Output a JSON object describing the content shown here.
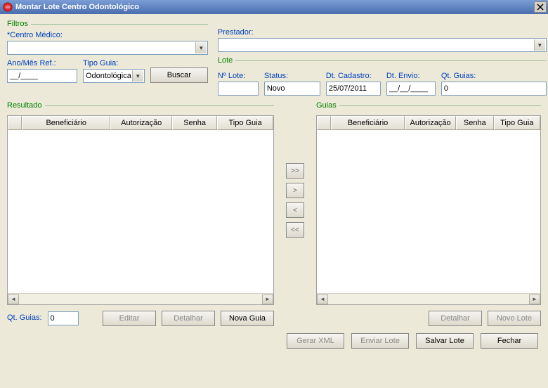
{
  "title": "Montar Lote Centro Odontológico",
  "close_x": "X",
  "fieldset_labels": {
    "filtros": "Filtros",
    "resultado": "Resultado",
    "lote": "Lote",
    "guias": "Guias"
  },
  "labels": {
    "centro_medico": "*Centro Médico:",
    "prestador": "Prestador:",
    "ano_mes_ref": "Ano/Mês Ref.:",
    "tipo_guia": "Tipo Guia:",
    "no_lote": "Nº Lote:",
    "status": "Status:",
    "dt_cadastro": "Dt. Cadastro:",
    "dt_envio": "Dt. Envio:",
    "qt_guias": "Qt. Guias:",
    "qt_guias_bottom": "Qt. Guias:"
  },
  "values": {
    "centro_medico": "",
    "prestador": "",
    "ano_mes_ref": "__/____",
    "tipo_guia": "Odontológica",
    "no_lote": "",
    "status": "Novo",
    "dt_cadastro": "25/07/2011",
    "dt_envio": "__/__/____",
    "qt_guias": "0",
    "qt_guias_bottom": "0"
  },
  "buttons": {
    "buscar": "Buscar",
    "editar": "Editar",
    "detalhar": "Detalhar",
    "nova_guia": "Nova Guia",
    "detalhar2": "Detalhar",
    "novo_lote": "Novo Lote",
    "gerar_xml": "Gerar XML",
    "enviar_lote": "Enviar Lote",
    "salvar_lote": "Salvar Lote",
    "fechar": "Fechar",
    "move_all_right": ">>",
    "move_right": ">",
    "move_left": "<",
    "move_all_left": "<<"
  },
  "table_headers": {
    "beneficiario": "Beneficiário",
    "autorizacao": "Autorização",
    "senha": "Senha",
    "tipo_guia": "Tipo Guia"
  },
  "scroll": {
    "left": "◄",
    "right": "►"
  }
}
